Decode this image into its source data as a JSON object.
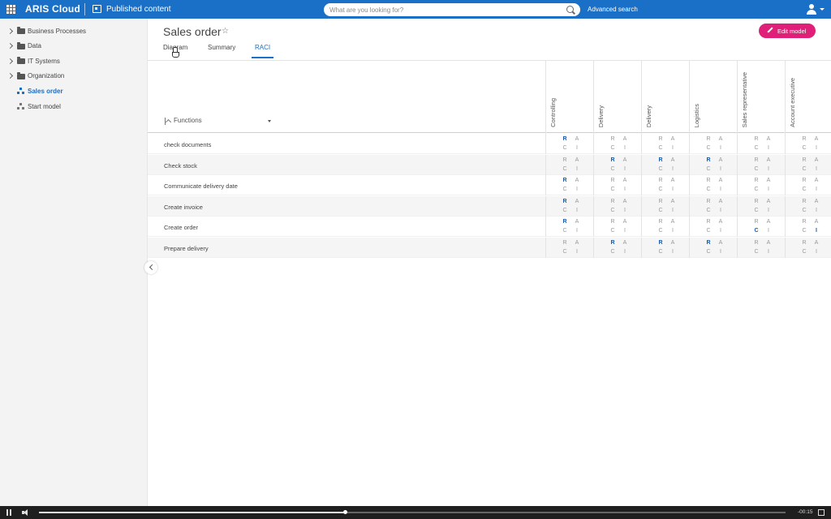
{
  "app": {
    "brand": "ARIS Cloud",
    "section": "Published content"
  },
  "search": {
    "placeholder": "What are you looking for?",
    "advanced_label": "Advanced search"
  },
  "sidebar": {
    "items": [
      {
        "label": "Business Processes",
        "icon": "folder-icon",
        "expandable": true,
        "active": false
      },
      {
        "label": "Data",
        "icon": "folder-icon",
        "expandable": true,
        "active": false
      },
      {
        "label": "IT Systems",
        "icon": "folder-icon",
        "expandable": true,
        "active": false
      },
      {
        "label": "Organization",
        "icon": "folder-icon",
        "expandable": true,
        "active": false
      },
      {
        "label": "Sales order",
        "icon": "model-icon",
        "expandable": false,
        "active": true
      },
      {
        "label": "Start model",
        "icon": "model-icon",
        "expandable": false,
        "active": false
      }
    ]
  },
  "page": {
    "title": "Sales order",
    "edit_label": "Edit model"
  },
  "tabs": [
    {
      "label": "Diagram",
      "active": false
    },
    {
      "label": "Summary",
      "active": false
    },
    {
      "label": "RACI",
      "active": true
    }
  ],
  "raci": {
    "functions_header": "Functions",
    "letters": [
      "R",
      "A",
      "C",
      "I"
    ],
    "columns": [
      "Controlling",
      "Delivery",
      "Delivery",
      "Logistics",
      "Sales representative",
      "Account executive"
    ],
    "rows": [
      {
        "label": "check documents",
        "cells": [
          [
            "R"
          ],
          [],
          [],
          [],
          [],
          []
        ]
      },
      {
        "label": "Check stock",
        "cells": [
          [],
          [
            "R"
          ],
          [
            "R"
          ],
          [
            "R"
          ],
          [],
          []
        ]
      },
      {
        "label": "Communicate delivery date",
        "cells": [
          [
            "R"
          ],
          [],
          [],
          [],
          [],
          []
        ]
      },
      {
        "label": "Create invoice",
        "cells": [
          [
            "R"
          ],
          [],
          [],
          [],
          [],
          []
        ]
      },
      {
        "label": "Create order",
        "cells": [
          [
            "R"
          ],
          [],
          [],
          [],
          [
            "C"
          ],
          [
            "I"
          ]
        ]
      },
      {
        "label": "Prepare delivery",
        "cells": [
          [],
          [
            "R"
          ],
          [
            "R"
          ],
          [
            "R"
          ],
          [],
          []
        ]
      }
    ]
  },
  "video": {
    "time": "-00:15",
    "progress": 0.41
  },
  "colors": {
    "topbar": "#1a6fc7",
    "accent": "#e01f78",
    "raci_active": "#1a5aa8"
  }
}
